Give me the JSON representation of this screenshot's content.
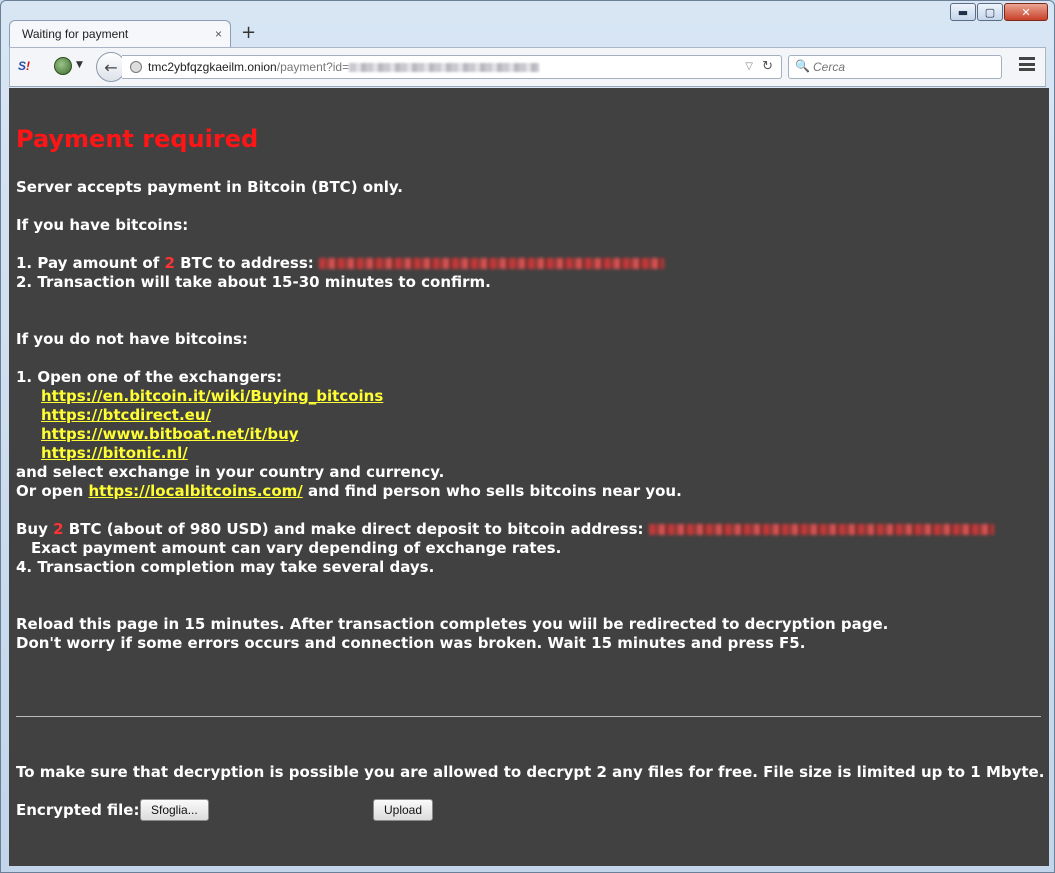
{
  "window": {
    "minimize_label": "▬",
    "maximize_label": "▢",
    "close_label": "✕"
  },
  "tabs": [
    {
      "title": "Waiting for payment",
      "close_label": "×"
    }
  ],
  "new_tab_label": "+",
  "toolbar": {
    "ext1_left": "S",
    "ext1_right": "!",
    "back_label": "←",
    "url_host": "tmc2ybfqzgkaeilm.onion",
    "url_path": "/payment?id=",
    "url_dropdown": "▽",
    "reload_label": "↻",
    "search_placeholder": "Cerca",
    "search_icon": "🔍"
  },
  "page": {
    "title": "Payment required",
    "intro": "Server accepts payment in Bitcoin (BTC) only.",
    "have_heading": "If you have bitcoins:",
    "have_step1_prefix": "1. Pay amount of",
    "amount": "2",
    "have_step1_suffix": "BTC to address:",
    "have_step2": "2. Transaction will take about 15-30 minutes to confirm.",
    "nothave_heading": "If you do not have bitcoins:",
    "nothave_step1": "1. Open one of the exchangers:",
    "exchangers": [
      "https://en.bitcoin.it/wiki/Buying_bitcoins",
      "https://btcdirect.eu/",
      "https://www.bitboat.net/it/buy",
      "https://bitonic.nl/"
    ],
    "select_exchange": "and select exchange in your country and currency.",
    "or_open_prefix": "Or open",
    "localbitcoins": "https://localbitcoins.com/",
    "or_open_suffix": "and find person who sells bitcoins near you.",
    "buy_prefix": "Buy",
    "buy_amount": "2",
    "buy_suffix": "BTC (about of 980 USD) and make direct deposit to bitcoin address:",
    "exact_amount": "Exact payment amount can vary depending of exchange rates.",
    "step4": "4. Transaction completion may take several days.",
    "reload_note": "Reload this page in 15 minutes. After transaction completes you wiil be redirected to decryption page.",
    "worry_note": "Don't worry if some errors occurs and connection was broken. Wait 15 minutes and press F5.",
    "decrypt_note": "To make sure that decryption is possible you are allowed to decrypt 2 any files for free. File size is limited up to 1 Mbyte.",
    "encrypted_label": "Encrypted file:",
    "browse_button": "Sfoglia...",
    "upload_button": "Upload"
  }
}
